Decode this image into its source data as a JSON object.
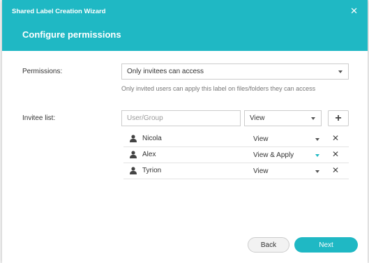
{
  "dialog": {
    "title": "Shared Label Creation Wizard",
    "subtitle": "Configure permissions",
    "close_icon": "close-icon"
  },
  "permissions": {
    "label": "Permissions:",
    "selected": "Only invitees can access",
    "hint": "Only invited users can apply this label on files/folders they can access"
  },
  "invitee": {
    "label": "Invitee list:",
    "input_placeholder": "User/Group",
    "permission_selected": "View",
    "add_icon": "plus-icon",
    "rows": [
      {
        "name": "Nicola",
        "permission": "View"
      },
      {
        "name": "Alex",
        "permission": "View & Apply"
      },
      {
        "name": "Tyrion",
        "permission": "View"
      }
    ]
  },
  "buttons": {
    "back": "Back",
    "next": "Next"
  },
  "colors": {
    "accent": "#1fb8c4"
  }
}
